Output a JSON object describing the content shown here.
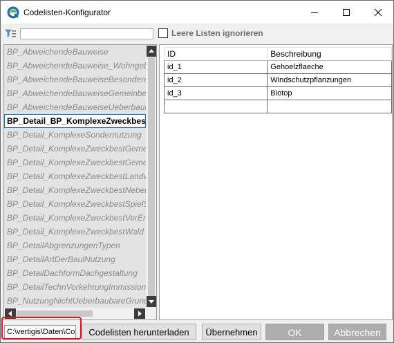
{
  "window": {
    "title": "Codelisten-Konfigurator"
  },
  "filter": {
    "value": "",
    "ignore_empty_label": "Leere Listen ignorieren",
    "ignore_empty_checked": false
  },
  "list": {
    "items": [
      "BP_AbweichendeBauweise",
      "BP_AbweichendeBauweise_WohngebaeudeI",
      "BP_AbweichendeBauweiseBesondererN",
      "BP_AbweichendeBauweiseGemeinbedarf",
      "BP_AbweichendeBauweiseUeberbaubar",
      "BP_Detail_BP_KomplexeZweckbestGemeinbedarf",
      "BP_Detail_KomplexeSondernutzung",
      "BP_Detail_KomplexeZweckbestGemeinbedarf",
      "BP_Detail_KomplexeZweckbestGemeinschaft",
      "BP_Detail_KomplexeZweckbestLandwirtschaft",
      "BP_Detail_KomplexeZweckbestNebenanlagen",
      "BP_Detail_KomplexeZweckbestSpielSportanlage",
      "BP_Detail_KomplexeZweckbestVerEntsorgung",
      "BP_Detail_KomplexeZweckbestWald",
      "BP_DetailAbgrenzungenTypen",
      "BP_DetailArtDerBaulNutzung",
      "BP_DetailDachformDachgestaltung",
      "BP_DetailTechnVorkehrungImmissionsschutz",
      "BP_NutzungNichtUeberbaubareGrundstuecksflaeche"
    ],
    "selected_index": 5
  },
  "grid": {
    "headers": [
      "ID",
      "Beschreibung"
    ],
    "rows": [
      [
        "id_1",
        "Gehoelzflaeche"
      ],
      [
        "id_2",
        "Windschutzpflanzungen"
      ],
      [
        "id_3",
        "Biotop"
      ],
      [
        "",
        ""
      ]
    ]
  },
  "bottom": {
    "path_value": "C:\\vertigis\\Daten\\Codelisten",
    "download_label": "Codelisten herunterladen",
    "apply_label": "Übernehmen",
    "ok_label": "OK",
    "cancel_label": "Abbrechen"
  },
  "colors": {
    "accent": "#0078d7",
    "highlight": "#e4131b",
    "disabled_button": "#adadad"
  }
}
